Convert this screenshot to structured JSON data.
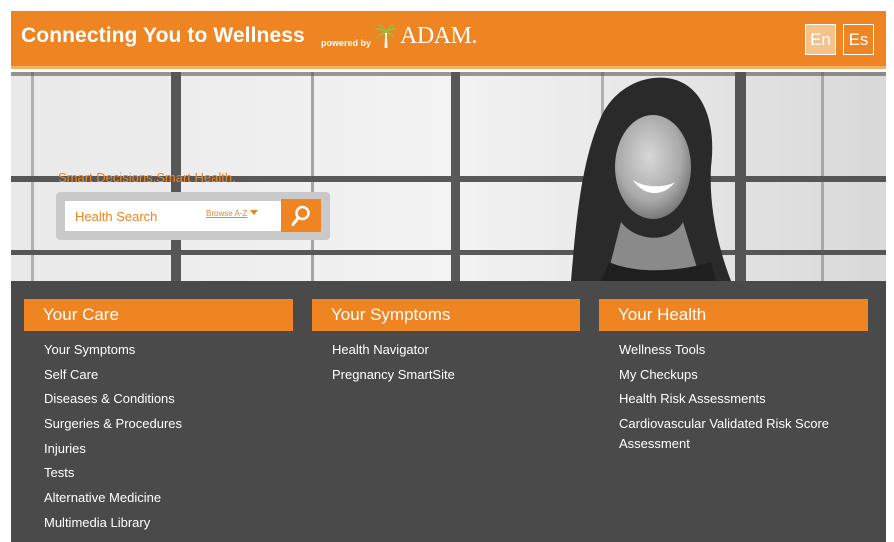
{
  "header": {
    "title": "Connecting You to Wellness",
    "powered_by": "powered by",
    "logo_text": "ADAM.",
    "lang_en": "En",
    "lang_es": "Es"
  },
  "hero": {
    "tagline": "Smart Decisions.Smart Health.",
    "search_label": "Health Search",
    "browse_link": "Browse A-Z"
  },
  "nav": {
    "columns": [
      {
        "title": "Your Care",
        "items": [
          "Your Symptoms",
          "Self Care",
          "Diseases & Conditions",
          "Surgeries & Procedures",
          "Injuries",
          "Tests",
          "Alternative Medicine",
          "Multimedia Library"
        ]
      },
      {
        "title": "Your Symptoms",
        "items": [
          "Health Navigator",
          "Pregnancy SmartSite"
        ]
      },
      {
        "title": "Your Health",
        "items": [
          "Wellness Tools",
          "My Checkups",
          "Health Risk Assessments",
          "Cardiovascular Validated Risk Score Assessment"
        ]
      }
    ]
  },
  "colors": {
    "accent": "#ee8522",
    "panel": "#4a4a4a",
    "search_frame": "#c9c9c9"
  },
  "icons": {
    "search": "search-icon",
    "caret": "caret-down-icon",
    "logo": "palm-tree-icon"
  }
}
